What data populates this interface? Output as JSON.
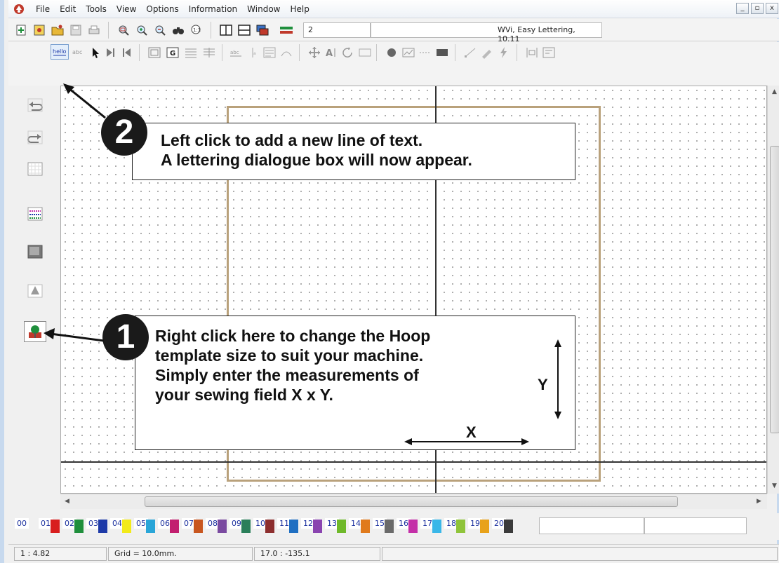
{
  "menu": {
    "items": [
      "File",
      "Edit",
      "Tools",
      "View",
      "Options",
      "Information",
      "Window",
      "Help"
    ]
  },
  "window_controls": {
    "minimize": "_",
    "maximize": "▫",
    "close": "x"
  },
  "toolbar": {
    "count_field": "2",
    "title_field": "WVi, Easy Lettering, 10.11"
  },
  "callouts": {
    "step2": {
      "number": "2",
      "line1": "Left click to add a new line of text.",
      "line2": "A lettering dialogue box will now appear."
    },
    "step1": {
      "number": "1",
      "line1": "Right click here to change the Hoop",
      "line2": "template size to suit your machine.",
      "line3": "Simply enter the measurements of",
      "line4": "your sewing field  X x Y."
    },
    "x_label": "X",
    "y_label": "Y"
  },
  "colors": {
    "labels": [
      "00",
      "01",
      "02",
      "03",
      "04",
      "05",
      "06",
      "07",
      "08",
      "09",
      "10",
      "11",
      "12",
      "13",
      "14",
      "15",
      "16",
      "17",
      "18",
      "19",
      "20"
    ],
    "chips": [
      "#ffffff",
      "#d81e1e",
      "#1f8f3c",
      "#1e3aa8",
      "#f2ea1a",
      "#2aa6d8",
      "#c21f6f",
      "#c8561f",
      "#7a4aa0",
      "#2a7f5a",
      "#8d2f2f",
      "#1f6fc2",
      "#8a44b0",
      "#6fb92a",
      "#e07a1c",
      "#6a6a6a",
      "#c42fa8",
      "#3ab7e8",
      "#8fc43a",
      "#e8a21a",
      "#3a3a3a"
    ]
  },
  "status": {
    "zoom": "1 : 4.82",
    "grid": "Grid = 10.0mm.",
    "coords": "17.0 : -135.1"
  },
  "accent": {
    "hoop_border": "#b9a17b",
    "callout_border": "#222222",
    "badge": "#1a1a1a"
  }
}
